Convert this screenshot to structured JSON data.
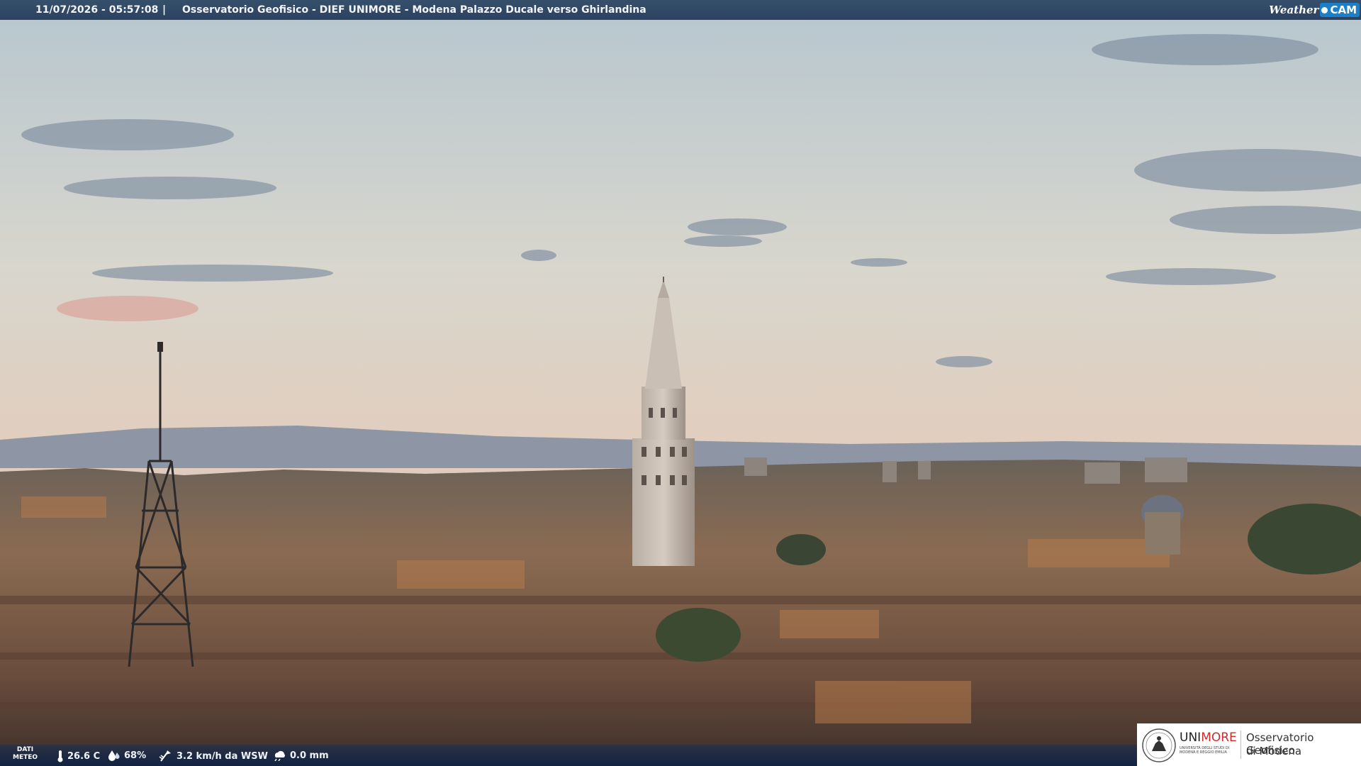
{
  "header": {
    "timestamp": "11/07/2026 - 05:57:08",
    "separator": "|",
    "title": "Osservatorio Geofisico - DIEF UNIMORE - Modena Palazzo Ducale verso Ghirlandina",
    "logo_weather": "Weather",
    "logo_cam": "CAM"
  },
  "weather": {
    "label_line1": "DATI",
    "label_line2": "METEO",
    "temperature": "26.6 C",
    "humidity": "68%",
    "wind": "3.2 km/h da WSW",
    "rain": "0.0 mm",
    "icons": [
      "thermometer-icon",
      "humidity-drop-icon",
      "wind-icon",
      "rain-icon"
    ]
  },
  "sponsor": {
    "uni": "UNI",
    "more": "MORE",
    "subtitle": "UNIVERSITÀ DEGLI STUDI DI MODENA E REGGIO EMILIA",
    "obs_line1": "Osservatorio Geofisico",
    "obs_line2": "di Modena"
  },
  "colors": {
    "header_bg": "#2b4260",
    "cam_badge": "#1c7fc9",
    "unimore_red": "#d02a2a"
  }
}
